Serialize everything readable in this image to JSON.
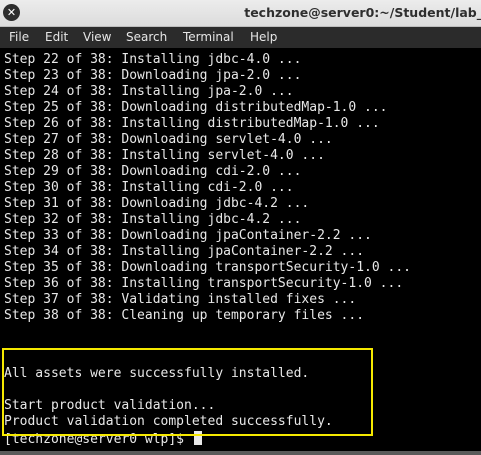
{
  "window": {
    "title": "techzone@server0:~/Student/lab_"
  },
  "menu": [
    "File",
    "Edit",
    "View",
    "Search",
    "Terminal",
    "Help"
  ],
  "terminal": {
    "steps": [
      "Step 22 of 38: Installing jdbc-4.0 ...",
      "Step 23 of 38: Downloading jpa-2.0 ...",
      "Step 24 of 38: Installing jpa-2.0 ...",
      "Step 25 of 38: Downloading distributedMap-1.0 ...",
      "Step 26 of 38: Installing distributedMap-1.0 ...",
      "Step 27 of 38: Downloading servlet-4.0 ...",
      "Step 28 of 38: Installing servlet-4.0 ...",
      "Step 29 of 38: Downloading cdi-2.0 ...",
      "Step 30 of 38: Installing cdi-2.0 ...",
      "Step 31 of 38: Downloading jdbc-4.2 ...",
      "Step 32 of 38: Installing jdbc-4.2 ...",
      "Step 33 of 38: Downloading jpaContainer-2.2 ...",
      "Step 34 of 38: Installing jpaContainer-2.2 ...",
      "Step 35 of 38: Downloading transportSecurity-1.0 ...",
      "Step 36 of 38: Installing transportSecurity-1.0 ...",
      "Step 37 of 38: Validating installed fixes ...",
      "Step 38 of 38: Cleaning up temporary files ..."
    ],
    "assets_message": "All assets were successfully installed.",
    "validation_start": "Start product validation...",
    "validation_done": "Product validation completed successfully.",
    "prompt": "[techzone@server0 wlp]$ "
  },
  "colors": {
    "terminal_bg": "#000000",
    "terminal_fg": "#e8e8e8",
    "highlight_border": "#f5e800",
    "menubar_bg": "#2b2b2b"
  },
  "icons": {
    "close": "close-icon"
  }
}
